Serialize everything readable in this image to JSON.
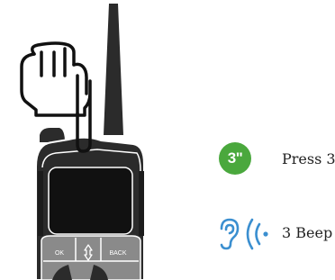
{
  "device": {
    "ok_label": "OK",
    "back_label": "BACK"
  },
  "steps": {
    "hold": {
      "duration": "3\"",
      "text": "Press 3"
    },
    "feedback": {
      "text": "3 Beep"
    }
  },
  "colors": {
    "badge": "#4aa83d",
    "icon": "#3b8fd0",
    "device_body": "#2b2b2b",
    "screen": "#111111",
    "keypad": "#8a8a8a"
  },
  "icons": [
    "hand-pointing-icon",
    "ear-icon",
    "sound-waves-icon"
  ]
}
